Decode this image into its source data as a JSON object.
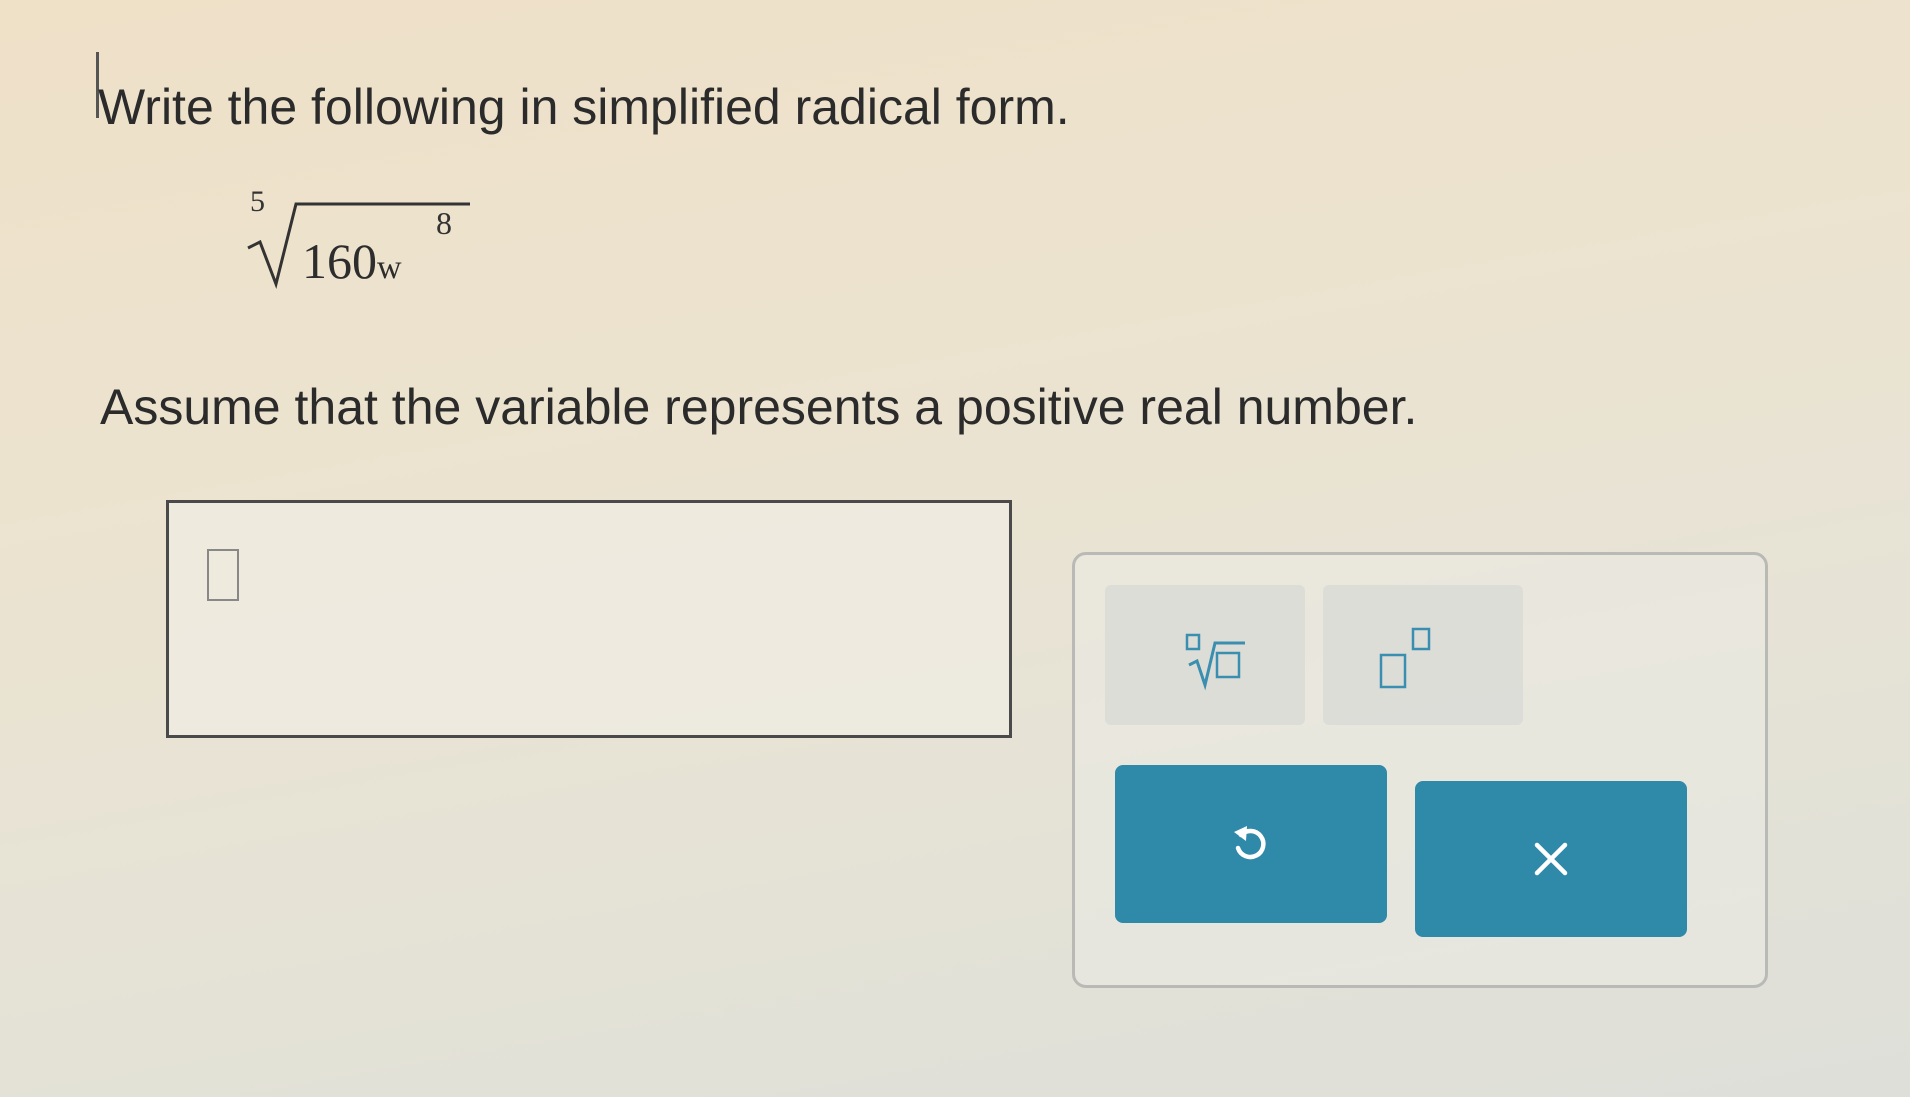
{
  "question": {
    "instruction": "Write the following in simplified radical form.",
    "expression": {
      "index": "5",
      "radicand_number": "160",
      "radicand_variable": "w",
      "exponent": "8"
    },
    "assumption": "Assume that the variable represents a positive real number."
  },
  "answer": {
    "value": ""
  },
  "toolbar": {
    "tools": [
      "nth-root-template",
      "exponent-template"
    ],
    "undo_icon": "undo-icon",
    "clear_icon": "close-icon",
    "button_color": "#2f89a8"
  }
}
